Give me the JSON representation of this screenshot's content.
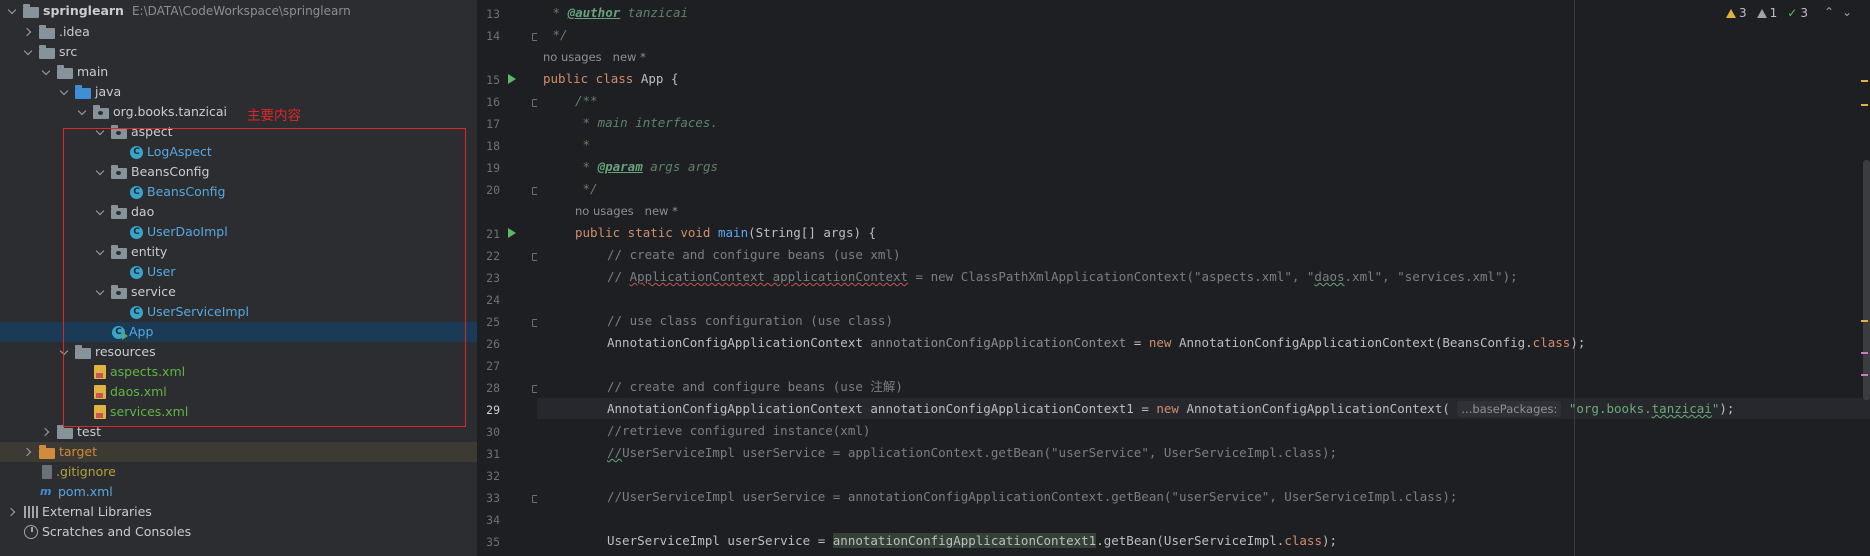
{
  "tree": {
    "project": "springlearn",
    "project_path": "E:\\DATA\\CodeWorkspace\\springlearn",
    "idea": ".idea",
    "src": "src",
    "main": "main",
    "java": "java",
    "package": "org.books.tanzicai",
    "aspect": "aspect",
    "log_aspect": "LogAspect",
    "beans_config_pkg": "BeansConfig",
    "beans_config_cls": "BeansConfig",
    "dao": "dao",
    "user_dao_impl": "UserDaoImpl",
    "entity": "entity",
    "user": "User",
    "service": "service",
    "user_service_impl": "UserServiceImpl",
    "app": "App",
    "resources": "resources",
    "aspects_xml": "aspects.xml",
    "daos_xml": "daos.xml",
    "services_xml": "services.xml",
    "test": "test",
    "target": "target",
    "gitignore": ".gitignore",
    "pom": "pom.xml",
    "external_libraries": "External Libraries",
    "scratches": "Scratches and Consoles",
    "annotation": "主要内容"
  },
  "editor": {
    "line_numbers": [
      "13",
      "14",
      "15",
      "16",
      "17",
      "18",
      "19",
      "20",
      "21",
      "22",
      "23",
      "24",
      "25",
      "26",
      "27",
      "28",
      "29",
      "30",
      "31",
      "32",
      "33",
      "34",
      "35"
    ],
    "hint_usages": "no usages",
    "hint_new": "new *",
    "param_hint": "...basePackages:",
    "indicators": {
      "warnings": "3",
      "weak_warnings": "1",
      "typos": "3"
    },
    "colors": {
      "keyword": "#cf8e6d",
      "string": "#6aab73",
      "comment": "#7a7e85",
      "doc": "#5f826b",
      "method": "#56a8f5"
    }
  }
}
